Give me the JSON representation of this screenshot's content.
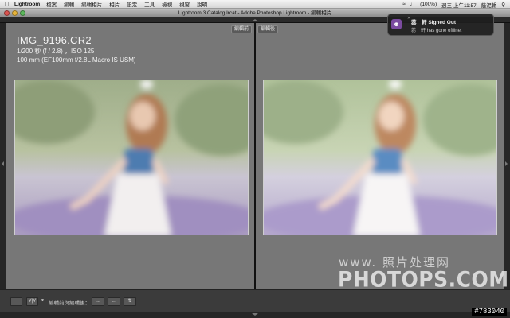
{
  "menubar": {
    "app": "Lightroom",
    "items": [
      "檔案",
      "編輯",
      "編輯相片",
      "相片",
      "設定",
      "工具",
      "檢視",
      "視窗",
      "說明"
    ],
    "battery": "(100%)",
    "clock": "週三 上午11:57",
    "user": "蔭泥輯"
  },
  "window": {
    "title": "Lightroom 3 Catalog.lrcat - Adobe Photoshop Lightroom - 編輯相片"
  },
  "before_pane": {
    "tag": "編輯前",
    "filename": "IMG_9196.CR2",
    "exposure": "1/200 秒 (f / 2.8) ，ISO 125",
    "lens": "100 mm (EF100mm f/2.8L Macro IS USM)"
  },
  "after_pane": {
    "tag": "編輯後"
  },
  "watermark": {
    "top": "www.  照片处理网",
    "main": "PHOTOPS.COM"
  },
  "toolbar": {
    "view_mode_label": "Y|Y",
    "compare_label": "編輯前與編輯後："
  },
  "notification": {
    "title": "Signed Out",
    "title_prefix": "蕊　軒",
    "message": "has gone offline.",
    "message_prefix": "蕊　軒"
  },
  "image_id": "#783040",
  "colors": {
    "pane_bg": "#777777",
    "toolbar_bg": "#3b3b3b",
    "notif_accent": "#7b4ba0"
  },
  "icons": {
    "apple": "apple-icon",
    "close": "close-icon",
    "search": "spotlight-icon"
  }
}
